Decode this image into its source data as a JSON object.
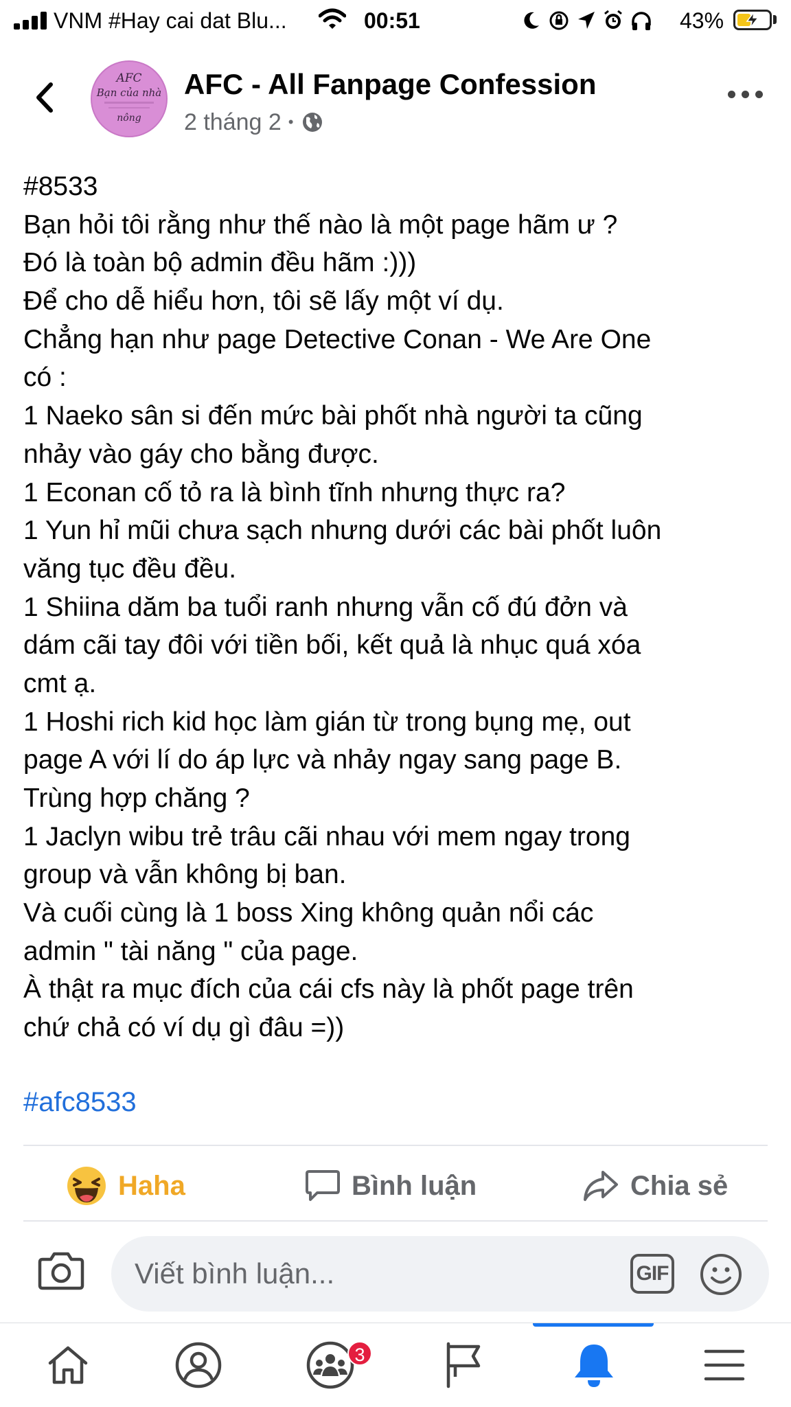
{
  "status_bar": {
    "carrier": "VNM #Hay cai dat Blu...",
    "time": "00:51",
    "battery_percent": "43%",
    "battery_level": 0.43,
    "icons": [
      "signal-icon",
      "wifi-icon",
      "moon-icon",
      "orientation-lock-icon",
      "location-arrow-icon",
      "alarm-icon",
      "headphones-icon",
      "battery-charging-icon"
    ]
  },
  "header": {
    "page_name": "AFC - All Fanpage Confession",
    "date": "2 tháng 2",
    "separator": "•",
    "privacy_icon": "globe-icon",
    "avatar": {
      "line1": "AFC",
      "line2": "Bạn của nhà",
      "line3": "nông",
      "bg_color": "#d98ed6"
    }
  },
  "post": {
    "lines": [
      "#8533",
      "Bạn hỏi tôi rằng như thế nào là một page hãm ư ?",
      "Đó là toàn bộ admin đều hãm :)))",
      "Để cho dễ hiểu hơn, tôi sẽ lấy một ví dụ.",
      "Chẳng hạn như page Detective Conan - We Are One",
      "có :",
      "1 Naeko sân si đến mức bài phốt nhà người ta cũng",
      "nhảy vào gáy cho bằng được.",
      "1 Econan cố tỏ ra là bình tĩnh nhưng thực ra?",
      "1 Yun hỉ mũi chưa sạch nhưng dưới các bài phốt luôn",
      "văng tục đều đều.",
      "1 Shiina dăm ba tuổi ranh nhưng vẫn cố đú đởn và",
      "dám cãi tay đôi với tiền bối, kết quả là nhục quá xóa",
      "cmt ạ.",
      "1 Hoshi rich kid học làm gián từ trong bụng mẹ, out",
      "page A với lí do áp lực và nhảy ngay sang page B.",
      "Trùng hợp chăng ?",
      "1 Jaclyn wibu trẻ trâu cãi nhau với mem ngay trong",
      "group và vẫn không bị ban.",
      "Và cuối cùng là 1 boss Xing không quản nổi các",
      "admin \" tài năng \" của page.",
      "À thật ra mục đích của cái cfs này là phốt page trên",
      "chứ chả có ví dụ gì đâu =))"
    ],
    "hashtag": "#afc8533",
    "hashtag_color": "#216fdb"
  },
  "actions": {
    "reaction_label": "Haha",
    "reaction_color": "#f0a826",
    "comment_label": "Bình luận",
    "share_label": "Chia sẻ"
  },
  "composer": {
    "placeholder": "Viết bình luận...",
    "gif_label": "GIF"
  },
  "tabbar": {
    "tabs": [
      "home-icon",
      "profile-icon",
      "groups-icon",
      "pages-flag-icon",
      "notifications-bell-icon",
      "menu-icon"
    ],
    "groups_badge": "3",
    "active_tab": "notifications-bell-icon",
    "accent_color": "#1877f2"
  }
}
